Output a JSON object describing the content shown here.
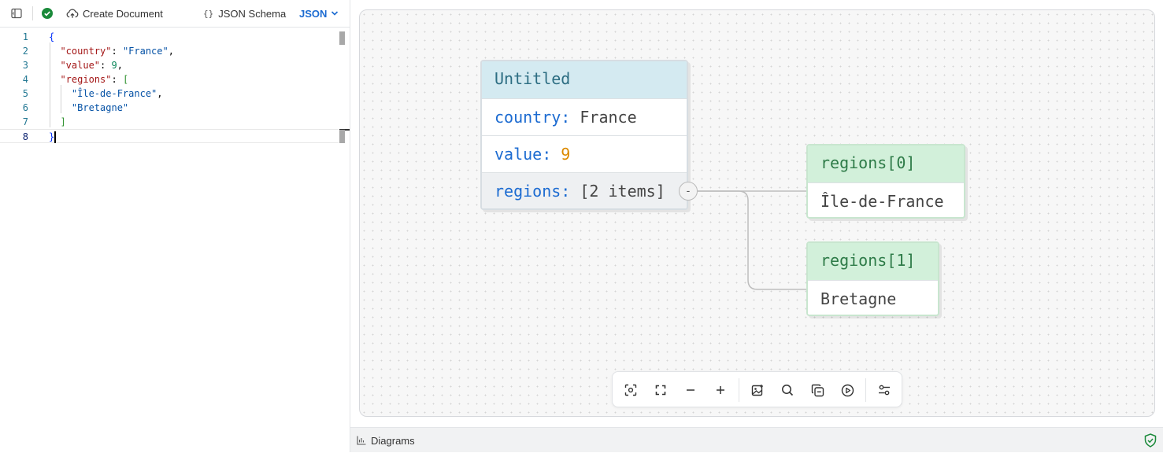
{
  "toolbar": {
    "create_label": "Create Document",
    "schema_label": "JSON Schema",
    "format_label": "JSON"
  },
  "editor": {
    "lines": [
      {
        "n": "1",
        "tokens": [
          {
            "t": "{",
            "c": "b1"
          }
        ]
      },
      {
        "n": "2",
        "tokens": [
          {
            "t": "  ",
            "c": "p"
          },
          {
            "t": "\"country\"",
            "c": "k"
          },
          {
            "t": ": ",
            "c": "p"
          },
          {
            "t": "\"France\"",
            "c": "s"
          },
          {
            "t": ",",
            "c": "p"
          }
        ]
      },
      {
        "n": "3",
        "tokens": [
          {
            "t": "  ",
            "c": "p"
          },
          {
            "t": "\"value\"",
            "c": "k"
          },
          {
            "t": ": ",
            "c": "p"
          },
          {
            "t": "9",
            "c": "n"
          },
          {
            "t": ",",
            "c": "p"
          }
        ]
      },
      {
        "n": "4",
        "tokens": [
          {
            "t": "  ",
            "c": "p"
          },
          {
            "t": "\"regions\"",
            "c": "k"
          },
          {
            "t": ": ",
            "c": "p"
          },
          {
            "t": "[",
            "c": "b2"
          }
        ]
      },
      {
        "n": "5",
        "tokens": [
          {
            "t": "    ",
            "c": "p"
          },
          {
            "t": "\"Île-de-France\"",
            "c": "s"
          },
          {
            "t": ",",
            "c": "p"
          }
        ]
      },
      {
        "n": "6",
        "tokens": [
          {
            "t": "    ",
            "c": "p"
          },
          {
            "t": "\"Bretagne\"",
            "c": "s"
          }
        ]
      },
      {
        "n": "7",
        "tokens": [
          {
            "t": "  ",
            "c": "p"
          },
          {
            "t": "]",
            "c": "b2"
          }
        ]
      },
      {
        "n": "8",
        "tokens": [
          {
            "t": "}",
            "c": "b1"
          }
        ]
      }
    ]
  },
  "graph": {
    "root": {
      "title": "Untitled",
      "country_key": "country:",
      "country_val": "France",
      "value_key": "value:",
      "value_val": "9",
      "regions_key": "regions:",
      "regions_val": "[2 items]"
    },
    "collapse_label": "-",
    "child0": {
      "title": "regions[0]",
      "value": "Île-de-France"
    },
    "child1": {
      "title": "regions[1]",
      "value": "Bretagne"
    }
  },
  "bottom": {
    "diagrams_label": "Diagrams"
  },
  "colors": {
    "accent": "#1c6bd1",
    "valid": "#1a8a3a",
    "root_header": "#d4eaf1",
    "child_header": "#d2f0da"
  },
  "icons": {
    "sidebar_toggle": "sidebar-icon",
    "valid": "check-circle-icon",
    "create": "cloud-upload-icon",
    "format_dropdown": "chevron-down-icon",
    "zoom_toolbar": [
      "focus-icon",
      "fullscreen-icon",
      "zoom-out-icon",
      "zoom-in-icon",
      "image-export-icon",
      "search-icon",
      "copy-icon",
      "play-icon",
      "settings-sliders-icon"
    ],
    "bottom": [
      "chart-icon",
      "shield-check-icon"
    ]
  }
}
